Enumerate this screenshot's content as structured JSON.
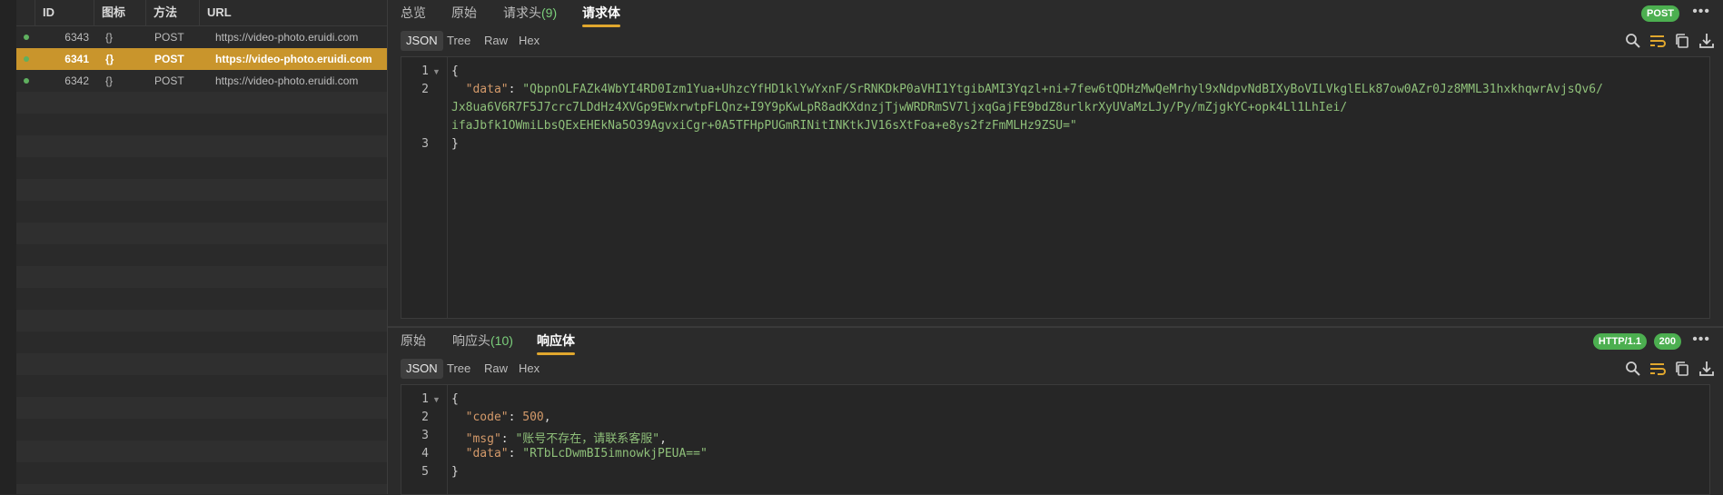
{
  "list": {
    "columns": [
      "ID",
      "图标",
      "方法",
      "URL"
    ],
    "rows": [
      {
        "id": "6343",
        "icon": "{}",
        "method": "POST",
        "url": "https://video-photo.eruidi.com"
      },
      {
        "id": "6341",
        "icon": "{}",
        "method": "POST",
        "url": "https://video-photo.eruidi.com"
      },
      {
        "id": "6342",
        "icon": "{}",
        "method": "POST",
        "url": "https://video-photo.eruidi.com"
      }
    ],
    "selected_row": 1
  },
  "request": {
    "tabs": {
      "overview": "总览",
      "raw": "原始",
      "headers": "请求头",
      "headers_count": "(9)",
      "body": "请求体"
    },
    "method_badge": "POST",
    "more": "•••",
    "view_modes": [
      "JSON",
      "Tree",
      "Raw",
      "Hex"
    ],
    "lines": {
      "n1": "1",
      "n2": "2",
      "n3": "3",
      "open": "{",
      "key": "\"data\"",
      "colon": ": ",
      "value_1": "\"QbpnOLFAZk4WbYI4RD0Izm1Yua+UhzcYfHD1klYwYxnF/SrRNKDkP0aVHI1YtgibAMI3Yqzl+ni+7few6tQDHzMwQeMrhyl9xNdpvNdBIXyBoVILVkglELk87ow0AZr0Jz8MML31hxkhqwrAvjsQv6/",
      "value_2": "Jx8ua6V6R7F5J7crc7LDdHz4XVGp9EWxrwtpFLQnz+I9Y9pKwLpR8adKXdnzjTjwWRDRmSV7ljxqGajFE9bdZ8urlkrXyUVaMzLJy/Py/mZjgkYC+opk4Ll1LhIei/",
      "value_3": "ifaJbfk1OWmiLbsQExEHEkNa5O39AgvxiCgr+0A5TFHpPUGmRINitINKtkJV16sXtFoa+e8ys2fzFmMLHz9ZSU=\"",
      "close": "}"
    }
  },
  "response": {
    "tabs": {
      "raw": "原始",
      "headers": "响应头",
      "headers_count": "(10)",
      "body": "响应体"
    },
    "protocol_badge": "HTTP/1.1",
    "status_badge": "200",
    "more": "•••",
    "view_modes": [
      "JSON",
      "Tree",
      "Raw",
      "Hex"
    ],
    "lines": {
      "n1": "1",
      "n2": "2",
      "n3": "3",
      "n4": "4",
      "n5": "5",
      "open": "{",
      "code_key": "\"code\"",
      "code_val": "500",
      "msg_key": "\"msg\"",
      "msg_val": "\"账号不存在，请联系客服\"",
      "data_key": "\"data\"",
      "data_val": "\"RTbLcDwmBI5imnowkjPEUA==\"",
      "colon": ": ",
      "comma": ",",
      "close": "}"
    }
  },
  "colors": {
    "accent": "#e0a72e",
    "selected_row": "#c9952c",
    "badge_green": "#4caf50",
    "string": "#8fc07a",
    "key": "#d49a6a"
  }
}
